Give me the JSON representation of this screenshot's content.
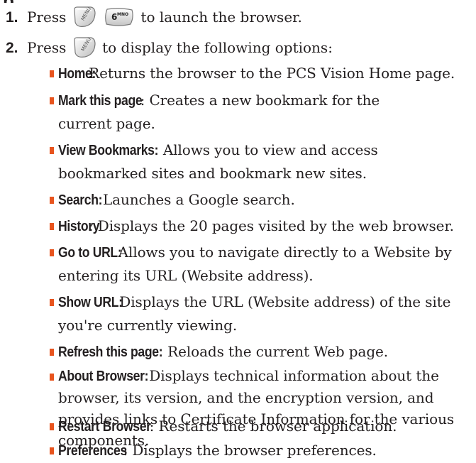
{
  "steps": [
    {
      "number": "1.",
      "before": "Press",
      "keys": [
        {
          "icon": "menu-key-icon",
          "label": "MENU"
        },
        {
          "icon": "six-key-icon",
          "digit": "6",
          "letters": "MNO"
        }
      ],
      "after": "to launch the browser."
    },
    {
      "number": "2.",
      "before": "Press",
      "keys": [
        {
          "icon": "menu-key-icon",
          "label": "MENU"
        }
      ],
      "after": "to display the following options:"
    }
  ],
  "options": [
    {
      "term": "Home:",
      "lines": [
        " Returns the browser to the PCS Vision Home page."
      ]
    },
    {
      "term": "Mark this page",
      "lines": [
        ": Creates a new bookmark for the",
        "current page."
      ]
    },
    {
      "term": "View Bookmarks:",
      "lines": [
        " Allows you to view and access",
        "bookmarked sites and bookmark new sites."
      ]
    },
    {
      "term": "Search:",
      "lines": [
        " Launches a Google search."
      ]
    },
    {
      "term": "History",
      "lines": [
        ": Displays the 20 pages visited by the web browser."
      ]
    },
    {
      "term": "Go to URL:",
      "lines": [
        " Allows you to navigate directly to a Website by",
        "entering its URL (Website address)."
      ]
    },
    {
      "term": "Show URL:",
      "lines": [
        " Displays the URL (Website address) of the site",
        "you're currently viewing."
      ]
    },
    {
      "term": "Refresh this page:",
      "lines": [
        " Reloads the current Web page."
      ]
    },
    {
      "term": "About Browser:",
      "lines": [
        " Displays technical information about the",
        "browser, its version, and the encryption version, and",
        "provides links to Certificate Information for the various",
        "components."
      ]
    },
    {
      "term": "Restart Browser",
      "lines": [
        ": Restarts the browser application."
      ]
    },
    {
      "term": "Preferences",
      "lines": [
        ": Displays the browser preferences."
      ]
    }
  ],
  "colors": {
    "bullet": "#e8541e",
    "text": "#231f20"
  }
}
